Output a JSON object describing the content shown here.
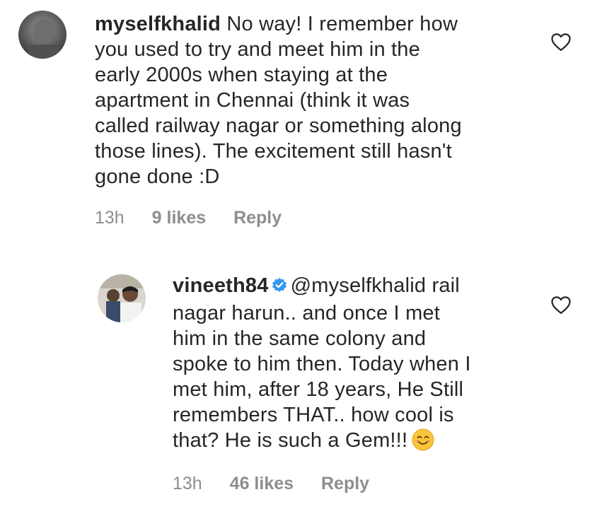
{
  "comments": [
    {
      "username": "myselfkhalid",
      "verified": false,
      "text": "No way! I remember how you used to try and meet him in the early 2000s when staying at the apartment in Chennai (think it was called railway nagar or something along those lines). The excitement still hasn't gone done :D",
      "lines": [
        "No way! I remember how",
        "you used to try and meet him in the",
        "early 2000s when staying at the",
        "apartment in Chennai (think it was",
        "called railway nagar or something along",
        "those lines). The excitement still hasn't",
        "gone done :D"
      ],
      "time": "13h",
      "likes": "9 likes",
      "reply_label": "Reply",
      "like_icon": "heart-outline-icon"
    },
    {
      "username": "vineeth84",
      "verified": true,
      "mention": "@myselfkhalid",
      "lines": [
        "rail",
        "nagar harun.. and once I met",
        "him in the same colony and",
        "spoke to him then. Today when I",
        "met him, after 18 years, He Still",
        "remembers THAT.. how cool is",
        "that? He is such a Gem!!!"
      ],
      "emoji": "smiling-face-emoji",
      "time": "13h",
      "likes": "46 likes",
      "reply_label": "Reply",
      "like_icon": "heart-outline-icon"
    }
  ],
  "colors": {
    "text": "#262626",
    "meta": "#8e8e8e",
    "verified_badge": "#3897f0"
  }
}
